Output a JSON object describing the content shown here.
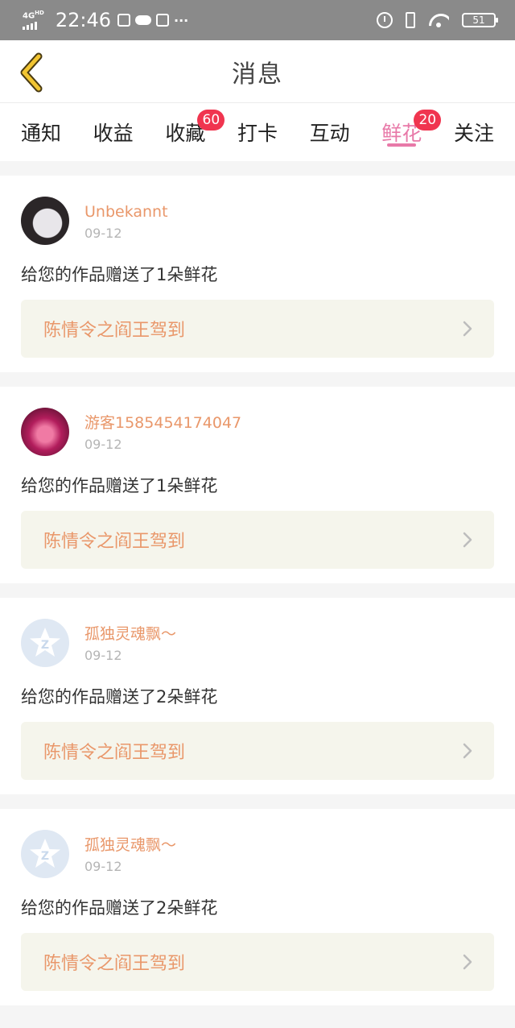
{
  "status_bar": {
    "network": "4G",
    "network_sup": "HD",
    "time": "22:46",
    "battery": "51"
  },
  "header": {
    "title": "消息"
  },
  "tabs": [
    {
      "label": "通知",
      "badge": "",
      "active": false
    },
    {
      "label": "收益",
      "badge": "",
      "active": false
    },
    {
      "label": "收藏",
      "badge": "60",
      "active": false
    },
    {
      "label": "打卡",
      "badge": "",
      "active": false
    },
    {
      "label": "互动",
      "badge": "",
      "active": false
    },
    {
      "label": "鲜花",
      "badge": "20",
      "active": true
    },
    {
      "label": "关注",
      "badge": "",
      "active": false
    }
  ],
  "messages": [
    {
      "username": "Unbekannt",
      "date": "09-12",
      "text": "给您的作品赠送了1朵鲜花",
      "work": "陈情令之阎王驾到",
      "avatar": "photo-dark"
    },
    {
      "username": "游客1585454174047",
      "date": "09-12",
      "text": "给您的作品赠送了1朵鲜花",
      "work": "陈情令之阎王驾到",
      "avatar": "photo-pink"
    },
    {
      "username": "孤独灵魂飘～",
      "date": "09-12",
      "text": "给您的作品赠送了2朵鲜花",
      "work": "陈情令之阎王驾到",
      "avatar": "default-star"
    },
    {
      "username": "孤独灵魂飘～",
      "date": "09-12",
      "text": "给您的作品赠送了2朵鲜花",
      "work": "陈情令之阎王驾到",
      "avatar": "default-star"
    }
  ],
  "colors": {
    "accent_pink": "#e879a8",
    "badge_red": "#f0354f",
    "username_orange": "#e9976a",
    "status_bar_gray": "#8a8a8a"
  }
}
